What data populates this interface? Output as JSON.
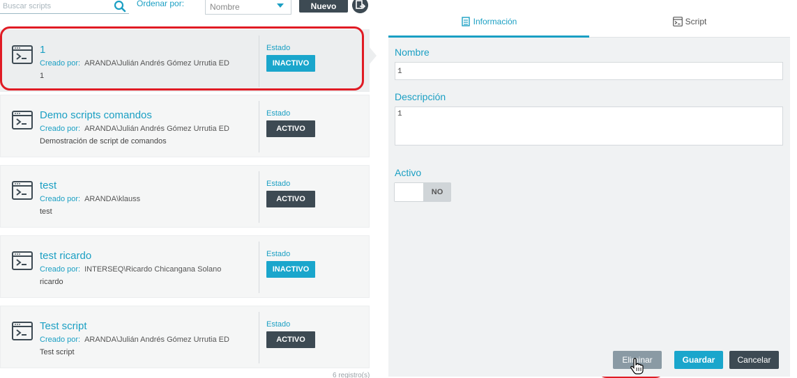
{
  "toolbar": {
    "search_placeholder": "Buscar scripts",
    "sort_label": "Ordenar por:",
    "sort_selected": "Nombre",
    "new_button": "Nuevo"
  },
  "list": {
    "items": [
      {
        "title": "1",
        "created_label": "Creado por:",
        "created_by": "ARANDA\\Julián Andrés Gómez Urrutia ED",
        "description": "1",
        "status_label": "Estado",
        "status": "INACTIVO",
        "selected": true
      },
      {
        "title": "Demo scripts comandos",
        "created_label": "Creado por:",
        "created_by": "ARANDA\\Julián Andrés Gómez Urrutia ED",
        "description": "Demostración de script de comandos",
        "status_label": "Estado",
        "status": "ACTIVO",
        "selected": false
      },
      {
        "title": "test",
        "created_label": "Creado por:",
        "created_by": "ARANDA\\klauss",
        "description": "test",
        "status_label": "Estado",
        "status": "ACTIVO",
        "selected": false
      },
      {
        "title": "test ricardo",
        "created_label": "Creado por:",
        "created_by": "INTERSEQ\\Ricardo Chicangana Solano",
        "description": "ricardo",
        "status_label": "Estado",
        "status": "INACTIVO",
        "selected": false
      },
      {
        "title": "Test script",
        "created_label": "Creado por:",
        "created_by": "ARANDA\\Julián Andrés Gómez Urrutia ED",
        "description": "Test script",
        "status_label": "Estado",
        "status": "ACTIVO",
        "selected": false
      }
    ],
    "record_count": "6 registro(s)"
  },
  "detail": {
    "tabs": [
      {
        "label": "Información",
        "active": true
      },
      {
        "label": "Script",
        "active": false
      }
    ],
    "name_label": "Nombre",
    "name_value": "1",
    "description_label": "Descripción",
    "description_value": "1",
    "active_label": "Activo",
    "active_toggle_value": "NO",
    "buttons": {
      "delete": "Eliminar",
      "save": "Guardar",
      "cancel": "Cancelar"
    }
  },
  "colors": {
    "accent": "#1a9fc3",
    "dark": "#3d4a53",
    "highlight_ring": "#e01b24"
  }
}
